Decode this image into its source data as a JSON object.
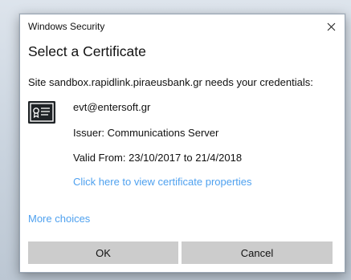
{
  "window": {
    "title": "Windows Security",
    "close_icon": "close-icon"
  },
  "dialog": {
    "heading": "Select a Certificate",
    "message": "Site sandbox.rapidlink.piraeusbank.gr needs your credentials:"
  },
  "certificate": {
    "icon": "certificate-icon",
    "name": "evt@entersoft.gr",
    "issuer": "Issuer: Communications Server",
    "valid": "Valid From: 23/10/2017 to 21/4/2018",
    "properties_link": "Click here to view certificate properties"
  },
  "more_choices": "More choices",
  "buttons": {
    "ok": "OK",
    "cancel": "Cancel"
  },
  "colors": {
    "link": "#4fa1ef",
    "button_bg": "#cccccc",
    "dialog_bg": "#ffffff"
  }
}
